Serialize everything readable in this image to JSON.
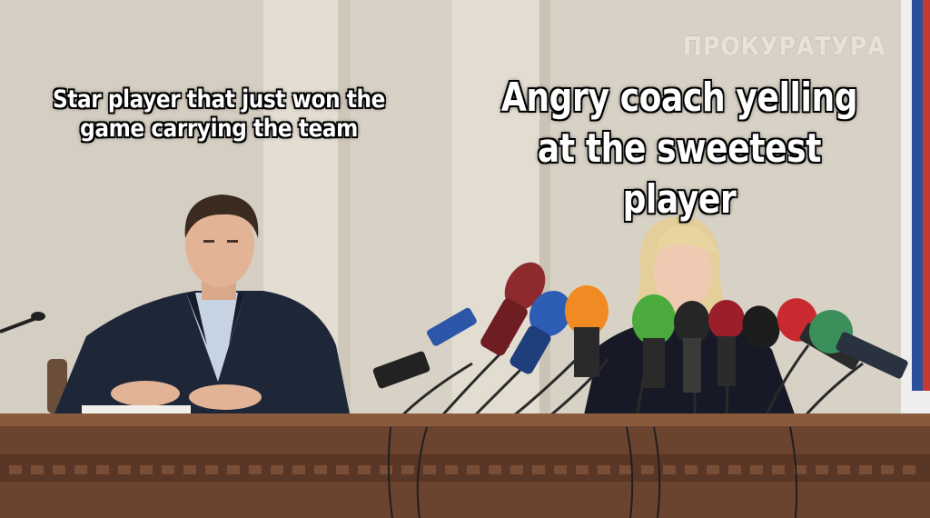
{
  "captions": {
    "left": "Star player that just won the game carrying the team",
    "right": "Angry coach yelling at the sweetest player"
  },
  "background_sign": "ПРОКУРАТУРА",
  "colors": {
    "caption_text": "#ffffff",
    "caption_outline": "#000000",
    "wall": "#d9d3c8",
    "desk": "#6b4430"
  }
}
